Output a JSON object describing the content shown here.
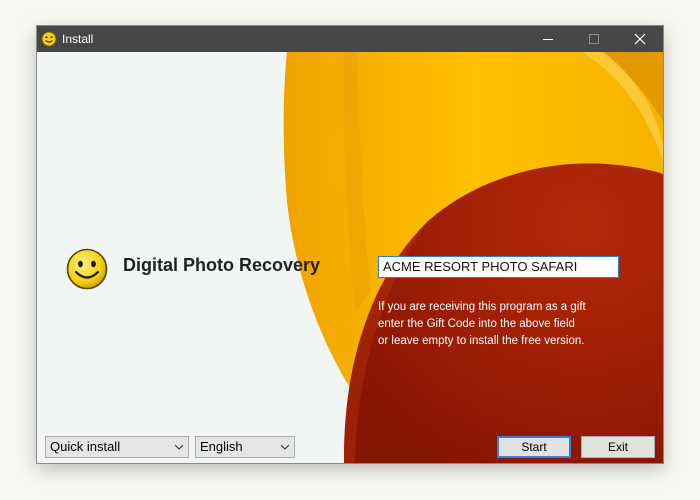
{
  "window": {
    "title": "Install",
    "controls": {
      "minimize_icon": "minimize-icon",
      "maximize_icon": "maximize-icon",
      "close_icon": "close-icon"
    }
  },
  "app": {
    "name": "Digital Photo Recovery",
    "logo_icon": "smiley-face-icon"
  },
  "gift_code": {
    "value": "ACME RESORT PHOTO SAFARI"
  },
  "info": {
    "lines": [
      "If you are receiving this program as a gift",
      "enter the Gift Code into the above field",
      "or leave empty to install the free version."
    ]
  },
  "footer": {
    "install_mode": {
      "selected": "Quick install"
    },
    "language": {
      "selected": "English"
    },
    "start_label": "Start",
    "exit_label": "Exit"
  },
  "colors": {
    "titlebar": "#474747",
    "yellow": "#f5b800",
    "dark_red": "#a41e06",
    "focus_blue": "#3c7fd6"
  }
}
